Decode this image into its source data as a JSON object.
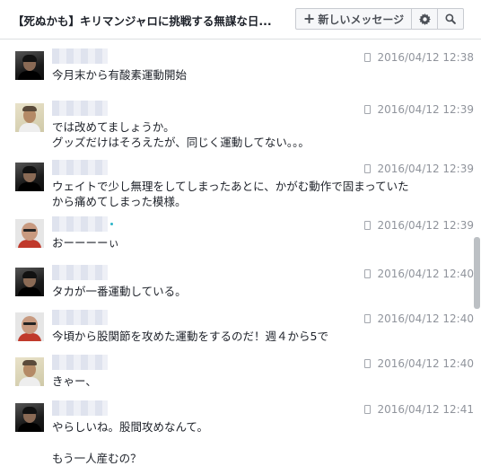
{
  "header": {
    "title": "【死ぬかも】キリマンジャロに挑戦する無謀な日...",
    "new_message_label": "新しいメッセージ",
    "new_icon": "plus-icon",
    "settings_icon": "gear-icon",
    "search_icon": "search-icon"
  },
  "messages": [
    {
      "avatar": "dark",
      "timestamp": "2016/04/12 12:38",
      "lines": [
        "今月末から有酸素運動開始"
      ]
    },
    {
      "avatar": "light",
      "timestamp": "2016/04/12 12:39",
      "lines": [
        "では改めてましょうか。",
        "グッズだけはそろえたが、同じく運動してない。。。"
      ]
    },
    {
      "avatar": "dark",
      "timestamp": "2016/04/12 12:39",
      "lines": [
        "ウェイトで少し無理をしてしまったあとに、かがむ動作で固まっていた",
        "から痛めてしまった模様。"
      ]
    },
    {
      "avatar": "bald",
      "timestamp": "2016/04/12 12:39",
      "lines": [
        "おーーーーぃ"
      ]
    },
    {
      "avatar": "dark",
      "timestamp": "2016/04/12 12:40",
      "lines": [
        "タカが一番運動している。"
      ]
    },
    {
      "avatar": "bald",
      "timestamp": "2016/04/12 12:40",
      "lines": [
        "今頃から股関節を攻めた運動をするのだ！週４から5で"
      ]
    },
    {
      "avatar": "light",
      "timestamp": "2016/04/12 12:40",
      "lines": [
        "きゃー、"
      ]
    },
    {
      "avatar": "dark",
      "timestamp": "2016/04/12 12:41",
      "lines": [
        "やらしいね。股間攻めなんて。",
        "もう一人産むの？"
      ]
    }
  ]
}
